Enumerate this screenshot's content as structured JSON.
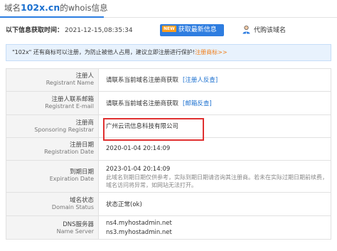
{
  "title": {
    "prefix": "域名",
    "domain": "102x.cn",
    "suffix": "的whois信息"
  },
  "meta": {
    "label": "以下信息获取时间：",
    "timestamp": "2021-12-15,08:35:34"
  },
  "refresh": {
    "badge": "NEW",
    "label": "获取最新信息"
  },
  "buy": {
    "label": "代购该域名"
  },
  "notice": {
    "text": "\"102x\" 还有商标可以注册，为防止被他人占用，建议立即注册进行保护!",
    "link": "注册商标>>"
  },
  "rows": [
    {
      "cn": "注册人",
      "en": "Registrant Name",
      "value": "请联系当前域名注册商获取",
      "link": "[注册人反查]"
    },
    {
      "cn": "注册人联系邮箱",
      "en": "Registrant E-mail",
      "value": "请联系当前域名注册商获取",
      "link": "[邮箱反查]"
    },
    {
      "cn": "注册商",
      "en": "Sponsoring Registrar",
      "value": "广州云讯信息科技有限公司"
    },
    {
      "cn": "注册日期",
      "en": "Registration Date",
      "value": "2020-01-04 20:14:09"
    },
    {
      "cn": "到期日期",
      "en": "Expiration Date",
      "value": "2023-01-04 20:14:09",
      "sub1": "此域名到期日期仅供参考，实际到期日期请咨询其注册商。若未在实际过期日期前续费，",
      "sub2": "域名访问将异常，如网站无法打开。"
    },
    {
      "cn": "域名状态",
      "en": "Domain Status",
      "value": "状态正常(ok)"
    },
    {
      "cn": "DNS服务器",
      "en": "Name Server",
      "value": "ns4.myhostadmin.net",
      "value2": "ns3.myhostadmin.net"
    }
  ],
  "colors": {
    "accent": "#2e7de0",
    "badge": "#ff9d1c",
    "highlight_border": "#e03030",
    "link": "#1a6fcf"
  }
}
